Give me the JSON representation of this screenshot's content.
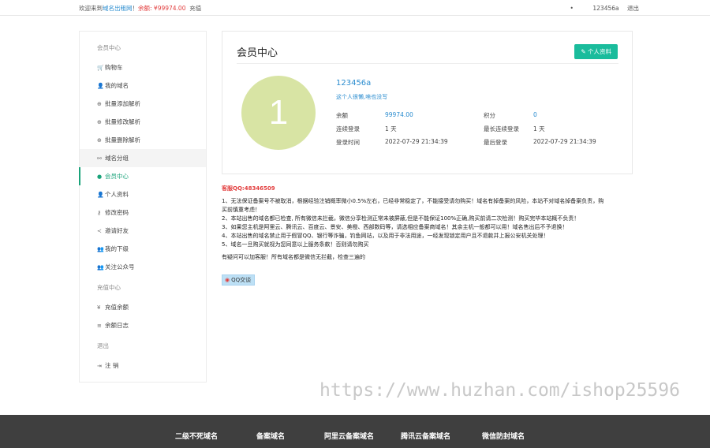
{
  "topbar": {
    "welcome": "欢迎来到",
    "site_link": "域名出租网",
    "welcome_end": "！",
    "balance_label": "余额: ¥",
    "balance_value": "99974.00",
    "recharge": "充值",
    "bullet": "•",
    "username": "123456a",
    "logout": "退出"
  },
  "sidebar": {
    "member_center": "会员中心",
    "items": [
      {
        "icon": "cart-icon",
        "glyph": "🛒",
        "label": "购物车"
      },
      {
        "icon": "user-icon",
        "glyph": "👤",
        "label": "我的域名"
      },
      {
        "icon": "add-icon",
        "glyph": "⊕",
        "label": "批量添加解析"
      },
      {
        "icon": "edit-icon",
        "glyph": "⊕",
        "label": "批量修改解析"
      },
      {
        "icon": "delete-icon",
        "glyph": "⊕",
        "label": "批量删除解析"
      },
      {
        "icon": "group-icon",
        "glyph": "⚯",
        "label": "域名分组"
      },
      {
        "icon": "member-icon",
        "glyph": "●",
        "label": "会员中心"
      },
      {
        "icon": "profile-icon",
        "glyph": "👤",
        "label": "个人资料"
      },
      {
        "icon": "key-icon",
        "glyph": "⚷",
        "label": "修改密码"
      },
      {
        "icon": "share-icon",
        "glyph": "≺",
        "label": "邀请好友"
      },
      {
        "icon": "team-icon",
        "glyph": "👥",
        "label": "我的下级"
      },
      {
        "icon": "wechat-icon",
        "glyph": "👥",
        "label": "关注公众号"
      }
    ],
    "recharge_center": "充值中心",
    "recharge_items": [
      {
        "icon": "yen-icon",
        "glyph": "¥",
        "label": "充值余额"
      },
      {
        "icon": "list-icon",
        "glyph": "≡",
        "label": "余额日志"
      }
    ],
    "exit_head": "退出",
    "exit_items": [
      {
        "icon": "logout-icon",
        "glyph": "⇥",
        "label": "注 销"
      }
    ]
  },
  "card": {
    "title": "会员中心",
    "profile_button": "个人资料",
    "avatar_text": "1",
    "username": "123456a",
    "signature": "这个人很懒,啥也没写",
    "balance_label": "余额",
    "balance_value": "99974.00",
    "points_label": "积分",
    "points_value": "0",
    "login_days_label": "连续登录",
    "login_days_value": "1 天",
    "longest_label": "最长连续登录",
    "longest_value": "1 天",
    "login_time_label": "登录时间",
    "login_time_value": "2022-07-29 21:34:39",
    "last_login_label": "最后登录",
    "last_login_value": "2022-07-29 21:34:39"
  },
  "notice": {
    "kf": "客服QQ:48346509",
    "lines": [
      "1、无法保证备案号不被取消，根据经验注销概率微小0.5%左右，已经非常稳定了，不能接受请勿购买！域名有掉备案的风险，本站不对域名掉备案负责，购",
      "买前慎重考虑！",
      "2、本站出售的域名都已检查, 所有微信未拦截，微信分享检测正常未被屏蔽,但是不能保证100%正确,购买前请二次检测！购买完毕本站概不负责！",
      "3、如果您主机是阿里云、腾讯云、百度云、景安、美橙、西部数码等，请选相应备案商域名！其余主机一般都可以用！域名售出后不予退换！",
      "4、本站出售的域名禁止用于假冒QQ、银行等诈骗，钓鱼网站，以及用于非法用途，一经发现锁定用户且不退款并上报公安机关处理！",
      "5、域名一旦购买就视为您同意以上服务条款！否则请勿购买"
    ],
    "tip": "有疑问可以加客服！所有域名都是微信无拦截，检查三遍的",
    "qq_button": "QQ交谈"
  },
  "watermark": "https://www.huzhan.com/ishop25596",
  "footer": {
    "links": [
      "二级不死域名",
      "备案域名",
      "阿里云备案域名",
      "腾讯云备案域名",
      "微信防封域名"
    ]
  }
}
